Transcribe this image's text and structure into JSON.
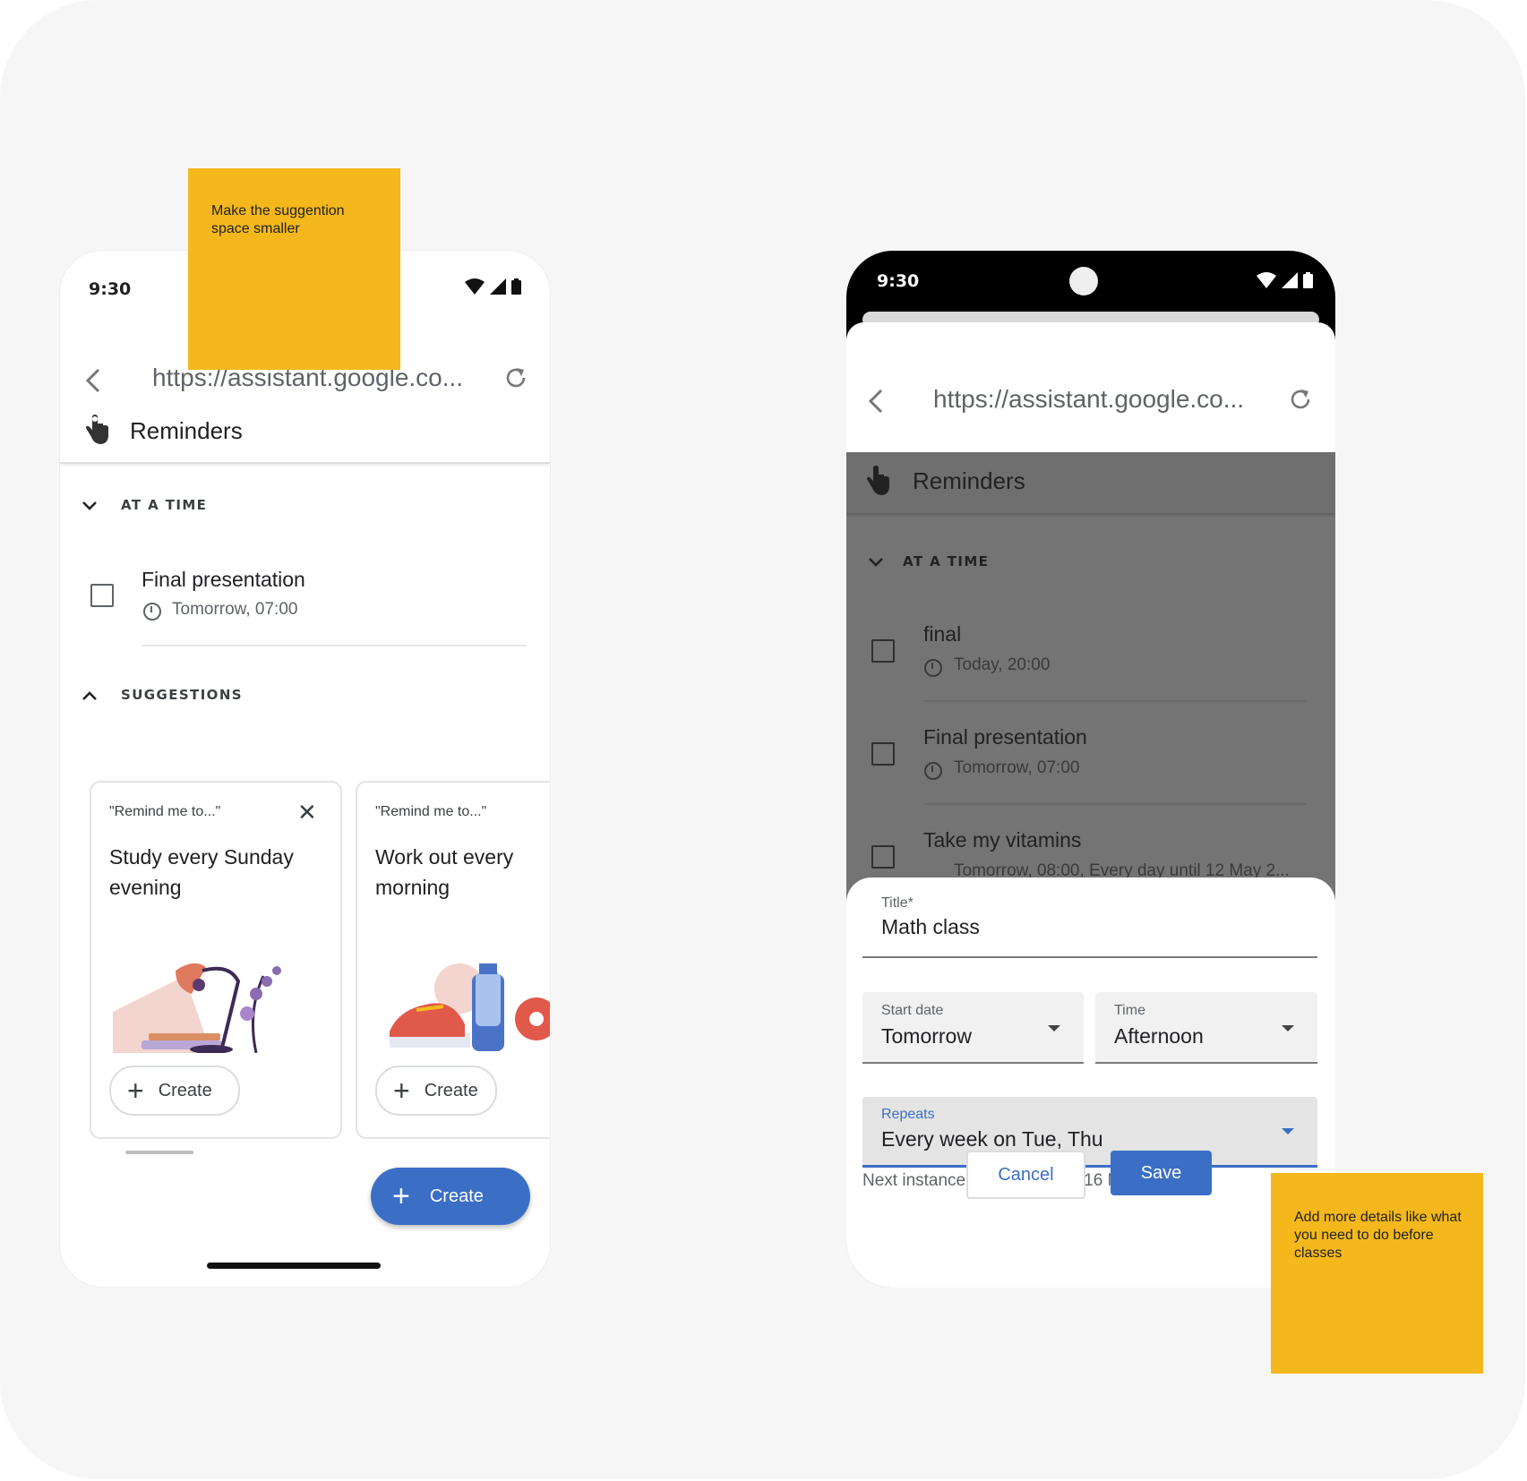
{
  "colors": {
    "accent": "#3b6fc6",
    "sticky": "#f4b81c",
    "board": "#f6f6f6"
  },
  "left_phone": {
    "status_time": "9:30",
    "url": "https://assistant.google.co...",
    "app_title": "Reminders",
    "section_at_a_time": "AT A TIME",
    "reminder": {
      "title": "Final presentation",
      "time": "Tomorrow, 07:00"
    },
    "section_suggestions": "SUGGESTIONS",
    "cards": [
      {
        "quote": "\"Remind me to...\"",
        "text": "Study every Sunday evening",
        "create": "Create"
      },
      {
        "quote": "\"Remind me to...\"",
        "text": "Work out every morning",
        "create": "Create"
      }
    ],
    "fab_label": "Create"
  },
  "right_phone": {
    "status_time": "9:30",
    "url": "https://assistant.google.co...",
    "app_title": "Reminders",
    "section_at_a_time": "AT A TIME",
    "reminders": [
      {
        "title": "final",
        "time": "Today, 20:00"
      },
      {
        "title": "Final presentation",
        "time": "Tomorrow, 07:00"
      },
      {
        "title": "Take my vitamins",
        "time": "Tomorrow, 08:00, Every day until 12 May 2..."
      }
    ],
    "form": {
      "title_label": "Title*",
      "title_value": "Math class",
      "start_date_label": "Start date",
      "start_date_value": "Tomorrow",
      "time_label": "Time",
      "time_value": "Afternoon",
      "repeats_label": "Repeats",
      "repeats_value": "Every week on Tue, Thu",
      "helper": "Next instance will be on Tue, 16 May",
      "cancel": "Cancel",
      "save": "Save"
    }
  },
  "notes": {
    "top": "Make the suggention space smaller",
    "bottom": "Add more details like what you need to do before classes"
  }
}
